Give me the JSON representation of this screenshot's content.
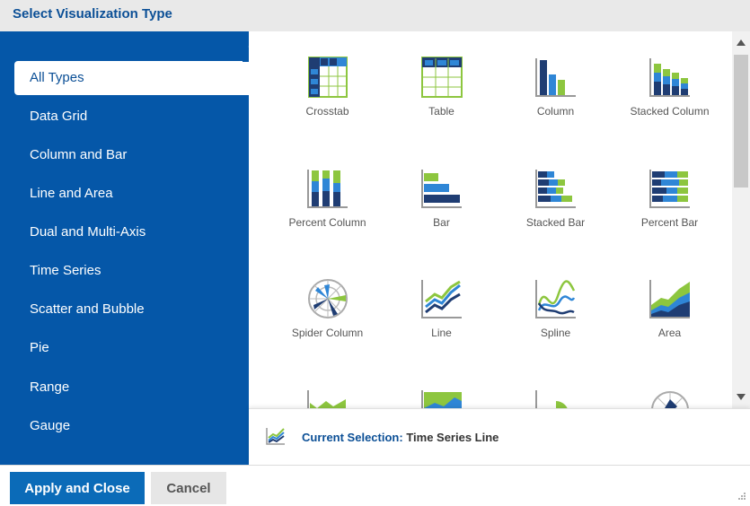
{
  "dialog": {
    "title": "Select Visualization Type"
  },
  "sidebar": {
    "items": [
      {
        "label": "All Types",
        "active": true
      },
      {
        "label": "Data Grid"
      },
      {
        "label": "Column and Bar"
      },
      {
        "label": "Line and Area"
      },
      {
        "label": "Dual and Multi-Axis"
      },
      {
        "label": "Time Series"
      },
      {
        "label": "Scatter and Bubble"
      },
      {
        "label": "Pie"
      },
      {
        "label": "Range"
      },
      {
        "label": "Gauge"
      }
    ]
  },
  "grid": {
    "tiles": [
      {
        "label": "Crosstab",
        "icon": "crosstab-icon"
      },
      {
        "label": "Table",
        "icon": "table-icon"
      },
      {
        "label": "Column",
        "icon": "column-chart-icon"
      },
      {
        "label": "Stacked Column",
        "icon": "stacked-column-icon"
      },
      {
        "label": "Percent Column",
        "icon": "percent-column-icon"
      },
      {
        "label": "Bar",
        "icon": "bar-chart-icon"
      },
      {
        "label": "Stacked Bar",
        "icon": "stacked-bar-icon"
      },
      {
        "label": "Percent Bar",
        "icon": "percent-bar-icon"
      },
      {
        "label": "Spider Column",
        "icon": "spider-column-icon"
      },
      {
        "label": "Line",
        "icon": "line-chart-icon"
      },
      {
        "label": "Spline",
        "icon": "spline-chart-icon"
      },
      {
        "label": "Area",
        "icon": "area-chart-icon"
      }
    ]
  },
  "selection": {
    "label": "Current Selection:",
    "value": "Time Series Line",
    "icon": "time-series-line-icon"
  },
  "footer": {
    "apply_label": "Apply and Close",
    "cancel_label": "Cancel"
  },
  "colors": {
    "brand_blue": "#0557a8",
    "dark_navy": "#1f3d73",
    "mid_blue": "#2f86d6",
    "lime_green": "#8dc63f"
  }
}
